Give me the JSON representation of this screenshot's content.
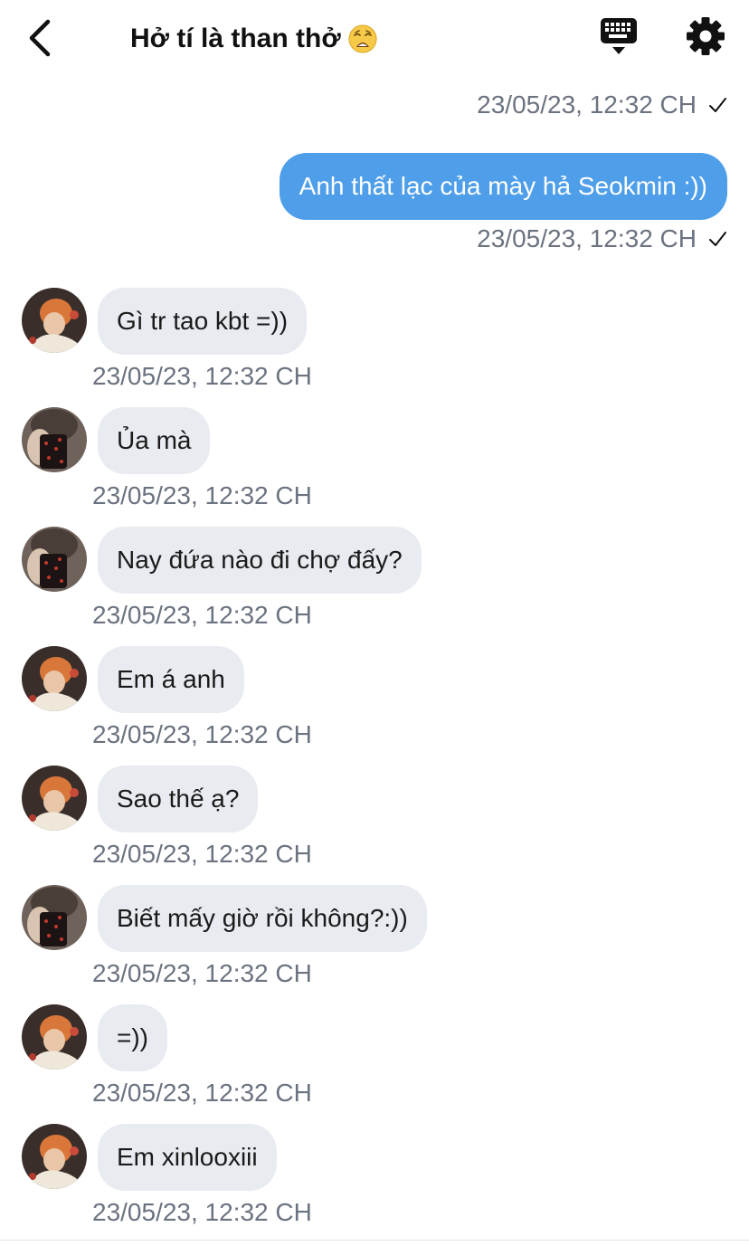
{
  "header": {
    "title": "Hở tí là than thở",
    "title_emoji": "weary-face-emoji",
    "back_icon": "chevron-left-icon",
    "keyboard_icon": "keyboard-icon",
    "settings_icon": "gear-icon"
  },
  "colors": {
    "outgoing_bubble": "#4e9ee9",
    "incoming_bubble": "#e8ebf0",
    "timestamp": "#6b7380"
  },
  "outgoing": {
    "top_timestamp": "23/05/23, 12:32 CH",
    "text": "Anh thất lạc của mày hả Seokmin :))",
    "timestamp": "23/05/23, 12:32 CH"
  },
  "incoming": [
    {
      "avatar": "orange-hair-avatar",
      "text": "Gì tr tao kbt =))",
      "timestamp": "23/05/23, 12:32 CH"
    },
    {
      "avatar": "mirror-selfie-avatar",
      "text": "Ủa mà",
      "timestamp": "23/05/23, 12:32 CH"
    },
    {
      "avatar": "mirror-selfie-avatar",
      "text": "Nay đứa nào đi chợ đấy?",
      "timestamp": "23/05/23, 12:32 CH"
    },
    {
      "avatar": "orange-hair-avatar",
      "text": "Em á anh",
      "timestamp": "23/05/23, 12:32 CH"
    },
    {
      "avatar": "orange-hair-avatar",
      "text": "Sao thế ạ?",
      "timestamp": "23/05/23, 12:32 CH"
    },
    {
      "avatar": "mirror-selfie-avatar",
      "text": "Biết mấy giờ rồi không?:))",
      "timestamp": "23/05/23, 12:32 CH"
    },
    {
      "avatar": "orange-hair-avatar",
      "text": "=))",
      "timestamp": "23/05/23, 12:32 CH"
    },
    {
      "avatar": "orange-hair-avatar",
      "text": "Em xinlooxiii",
      "timestamp": "23/05/23, 12:32 CH"
    }
  ]
}
